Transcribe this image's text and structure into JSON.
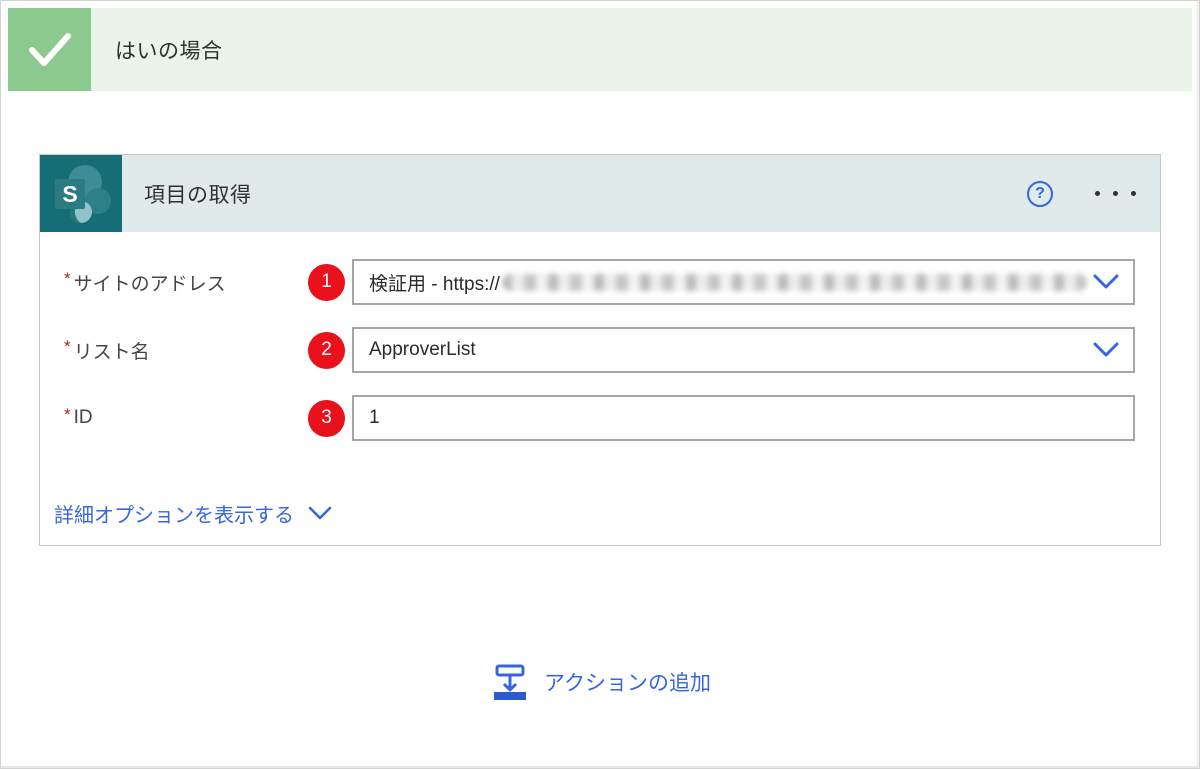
{
  "ui": {
    "required_marker": "*"
  },
  "branch": {
    "title": "はいの場合"
  },
  "action_card": {
    "title": "項目の取得",
    "connector": "SharePoint",
    "help_icon_glyph": "?",
    "logo_letter": "S",
    "fields": [
      {
        "label": "サイトのアドレス",
        "badge": "1",
        "value": "検証用 - https://",
        "value_redacted": true,
        "has_dropdown": true
      },
      {
        "label": "リスト名",
        "badge": "2",
        "value": "ApproverList",
        "value_redacted": false,
        "has_dropdown": true
      },
      {
        "label": "ID",
        "badge": "3",
        "value": "1",
        "value_redacted": false,
        "has_dropdown": false
      }
    ],
    "advanced_options_label": "詳細オプションを表示する"
  },
  "add_action": {
    "label": "アクションの追加"
  },
  "colors": {
    "accent_blue": "#3566e0",
    "badge_red": "#e8111c",
    "branch_green": "#8cc98f",
    "branch_green_light": "#eaf4eb",
    "card_header_teal": "#e1eaeb",
    "sharepoint_teal": "#05767d"
  }
}
